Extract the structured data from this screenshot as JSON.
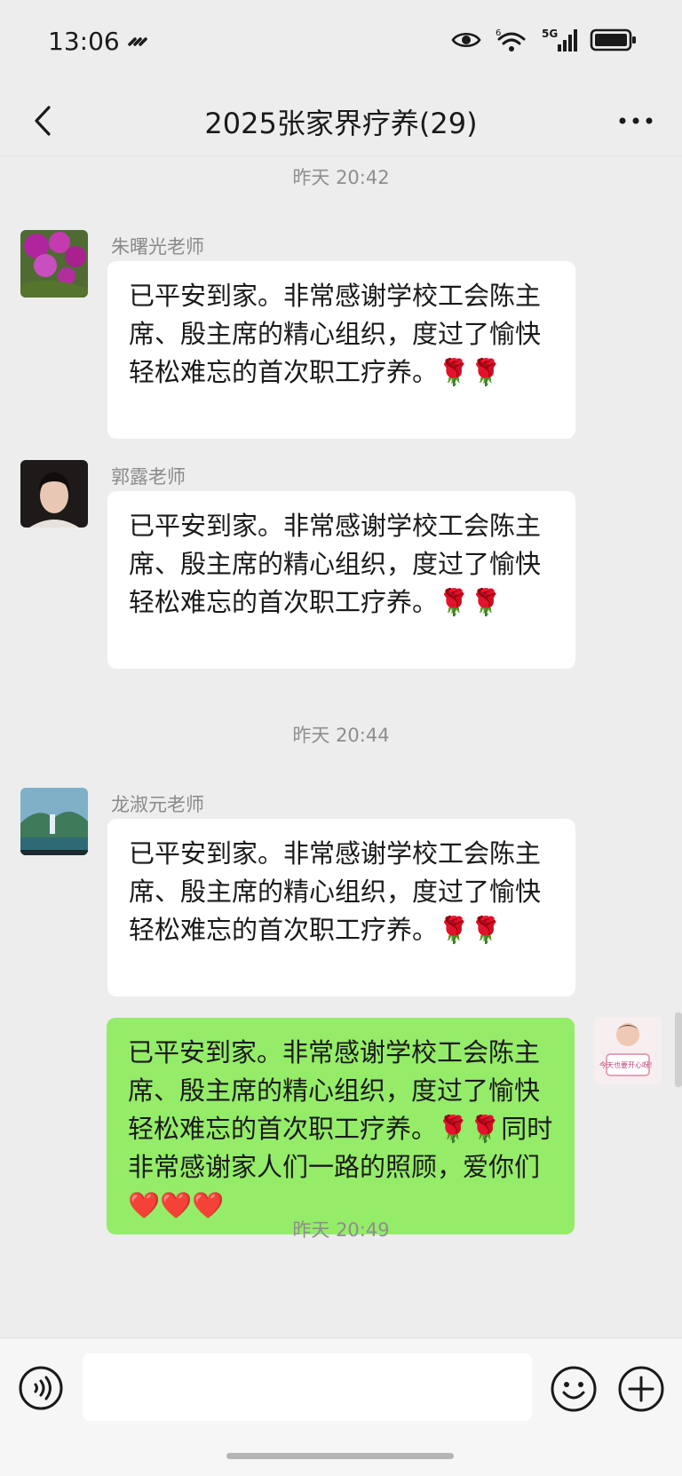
{
  "status": {
    "time": "13:06",
    "icons": [
      "link-icon",
      "eye-icon",
      "wifi-icon",
      "signal-5g-icon",
      "battery-icon"
    ],
    "wifi_badge": "6",
    "network": "5G"
  },
  "nav": {
    "title": "2025张家界疗养(29)",
    "back_icon": "chevron-left-icon",
    "more_icon": "more-dots-icon"
  },
  "messages": {
    "ts1": "昨天 20:42",
    "ts2": "昨天 20:44",
    "ts3": "昨天 20:49",
    "m1": {
      "sender": "朱曙光老师",
      "text": "已平安到家。非常感谢学校工会陈主席、殷主席的精心组织，度过了愉快轻松难忘的首次职工疗养。🌹🌹"
    },
    "m2": {
      "sender": "郭露老师",
      "text": "已平安到家。非常感谢学校工会陈主席、殷主席的精心组织，度过了愉快轻松难忘的首次职工疗养。🌹🌹"
    },
    "m3": {
      "sender": "龙淑元老师",
      "text": "已平安到家。非常感谢学校工会陈主席、殷主席的精心组织，度过了愉快轻松难忘的首次职工疗养。🌹🌹"
    },
    "m4": {
      "text": "已平安到家。非常感谢学校工会陈主席、殷主席的精心组织，度过了愉快轻松难忘的首次职工疗养。🌹🌹同时非常感谢家人们一路的照顾，爱你们❤️❤️❤️",
      "avatar_caption": "今天也要开心呀！"
    }
  },
  "input": {
    "voice_icon": "voice-icon",
    "emoji_icon": "emoji-icon",
    "plus_icon": "plus-icon",
    "value": ""
  },
  "colors": {
    "background": "#ededed",
    "incoming_bubble": "#ffffff",
    "outgoing_bubble": "#95ec69",
    "timestamp": "#8e8e8e"
  }
}
